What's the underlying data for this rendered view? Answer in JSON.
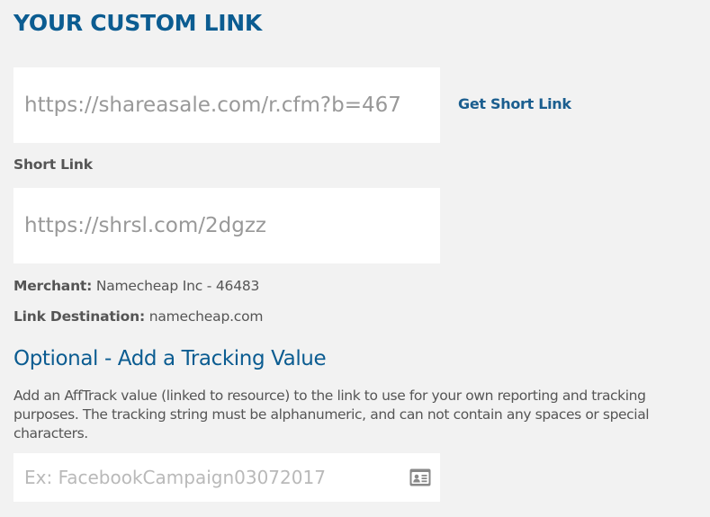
{
  "page": {
    "title": "YOUR CUSTOM LINK"
  },
  "custom_link": {
    "value": "https://shareasale.com/r.cfm?b=467",
    "get_short_label": "Get Short Link"
  },
  "short_link": {
    "label": "Short Link",
    "value": "https://shrsl.com/2dgzz"
  },
  "merchant": {
    "label": "Merchant:",
    "value": "Namecheap Inc - 46483"
  },
  "destination": {
    "label": "Link Destination:",
    "value": "namecheap.com"
  },
  "tracking": {
    "title": "Optional - Add a Tracking Value",
    "description": "Add an AffTrack value (linked to resource) to the link to use for your own reporting and tracking purposes. The tracking string must be alphanumeric, and can not contain any spaces or special characters.",
    "placeholder": "Ex: FacebookCampaign03072017",
    "icon": "id-card-icon"
  },
  "colors": {
    "accent": "#0b5c91",
    "background": "#f2f2f2",
    "text": "#555555",
    "field": "#ffffff"
  }
}
